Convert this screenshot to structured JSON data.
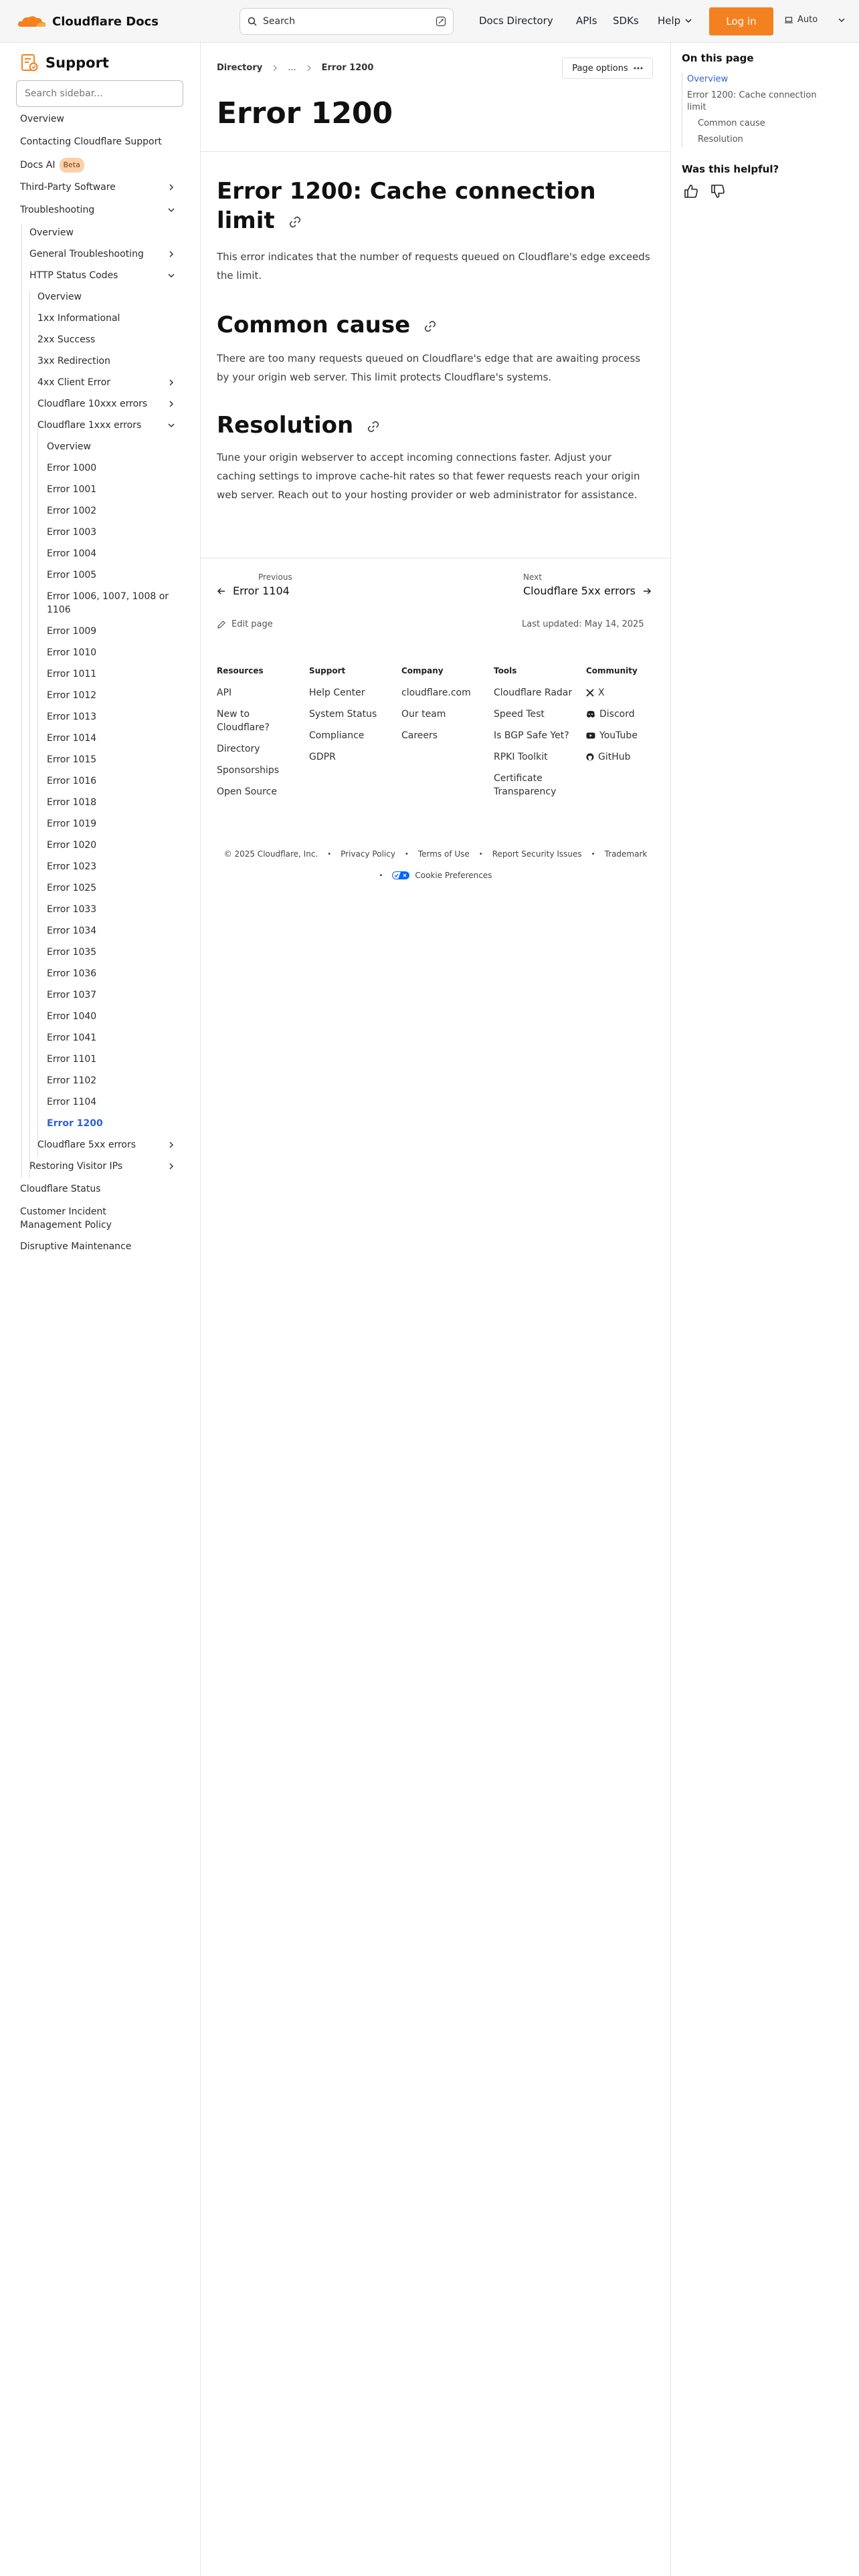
{
  "header": {
    "brand": "Cloudflare Docs",
    "search_placeholder": "Search",
    "nav": [
      "Docs Directory",
      "APIs",
      "SDKs",
      "Help"
    ],
    "login": "Log in",
    "theme": "Auto",
    "accent": "#f48120"
  },
  "sidebar": {
    "title": "Support",
    "search_placeholder": "Search sidebar...",
    "items": [
      {
        "label": "Overview"
      },
      {
        "label": "Contacting Cloudflare Support"
      },
      {
        "label": "Docs AI",
        "badge": "Beta"
      },
      {
        "label": "Third-Party Software"
      },
      {
        "label": "Troubleshooting"
      },
      {
        "label": "Overview"
      },
      {
        "label": "General Troubleshooting"
      },
      {
        "label": "HTTP Status Codes"
      },
      {
        "label": "Overview"
      },
      {
        "label": "1xx Informational"
      },
      {
        "label": "2xx Success"
      },
      {
        "label": "3xx Redirection"
      },
      {
        "label": "4xx Client Error"
      },
      {
        "label": "Cloudflare 10xxx errors"
      },
      {
        "label": "Cloudflare 1xxx errors"
      },
      {
        "label": "Overview"
      },
      {
        "label": "Error 1000"
      },
      {
        "label": "Error 1001"
      },
      {
        "label": "Error 1002"
      },
      {
        "label": "Error 1003"
      },
      {
        "label": "Error 1004"
      },
      {
        "label": "Error 1005"
      },
      {
        "label": "Error 1006, 1007, 1008 or 1106"
      },
      {
        "label": "Error 1009"
      },
      {
        "label": "Error 1010"
      },
      {
        "label": "Error 1011"
      },
      {
        "label": "Error 1012"
      },
      {
        "label": "Error 1013"
      },
      {
        "label": "Error 1014"
      },
      {
        "label": "Error 1015"
      },
      {
        "label": "Error 1016"
      },
      {
        "label": "Error 1018"
      },
      {
        "label": "Error 1019"
      },
      {
        "label": "Error 1020"
      },
      {
        "label": "Error 1023"
      },
      {
        "label": "Error 1025"
      },
      {
        "label": "Error 1033"
      },
      {
        "label": "Error 1034"
      },
      {
        "label": "Error 1035"
      },
      {
        "label": "Error 1036"
      },
      {
        "label": "Error 1037"
      },
      {
        "label": "Error 1040"
      },
      {
        "label": "Error 1041"
      },
      {
        "label": "Error 1101"
      },
      {
        "label": "Error 1102"
      },
      {
        "label": "Error 1104"
      },
      {
        "label": "Error 1200"
      },
      {
        "label": "Cloudflare 5xx errors"
      },
      {
        "label": "Restoring Visitor IPs"
      },
      {
        "label": "Cloudflare Status"
      },
      {
        "label": "Customer Incident Management Policy"
      },
      {
        "label": "Disruptive Maintenance"
      }
    ]
  },
  "main": {
    "breadcrumb": [
      "Directory",
      "...",
      "Error 1200"
    ],
    "page_options": "Page options",
    "title": "Error 1200",
    "h2_cache": "Error 1200: Cache connection limit",
    "p_cache": "This error indicates that the number of requests queued on Cloudflare's edge exceeds the limit.",
    "h2_cause": "Common cause",
    "p_cause": "There are too many requests queued on Cloudflare's edge that are awaiting process by your origin web server. This limit protects Cloudflare's systems.",
    "h2_resolution": "Resolution",
    "p_resolution": "Tune your origin webserver to accept incoming connections faster. Adjust your caching settings to improve cache-hit rates so that fewer requests reach your origin web server. Reach out to your hosting provider or web administrator for assistance.",
    "prev_label": "Previous",
    "prev_title": "Error 1104",
    "next_label": "Next",
    "next_title": "Cloudflare 5xx errors",
    "edit": "Edit page",
    "updated": "Last updated: May 14, 2025"
  },
  "footer": {
    "columns": [
      {
        "heading": "Resources",
        "links": [
          "API",
          "New to Cloudflare?",
          "Directory",
          "Sponsorships",
          "Open Source"
        ]
      },
      {
        "heading": "Support",
        "links": [
          "Help Center",
          "System Status",
          "Compliance",
          "GDPR"
        ]
      },
      {
        "heading": "Company",
        "links": [
          "cloudflare.com",
          "Our team",
          "Careers"
        ]
      },
      {
        "heading": "Tools",
        "links": [
          "Cloudflare Radar",
          "Speed Test",
          "Is BGP Safe Yet?",
          "RPKI Toolkit",
          "Certificate Transparency"
        ]
      },
      {
        "heading": "Community",
        "links": [
          "X",
          "Discord",
          "YouTube",
          "GitHub"
        ]
      }
    ],
    "copyright": "© 2025 Cloudflare, Inc.",
    "links": [
      "Privacy Policy",
      "Terms of Use",
      "Report Security Issues",
      "Trademark"
    ],
    "cookie": "Cookie Preferences"
  },
  "toc": {
    "heading": "On this page",
    "items": [
      "Overview",
      "Error 1200: Cache connection limit",
      "Common cause",
      "Resolution"
    ],
    "helpful": "Was this helpful?"
  }
}
